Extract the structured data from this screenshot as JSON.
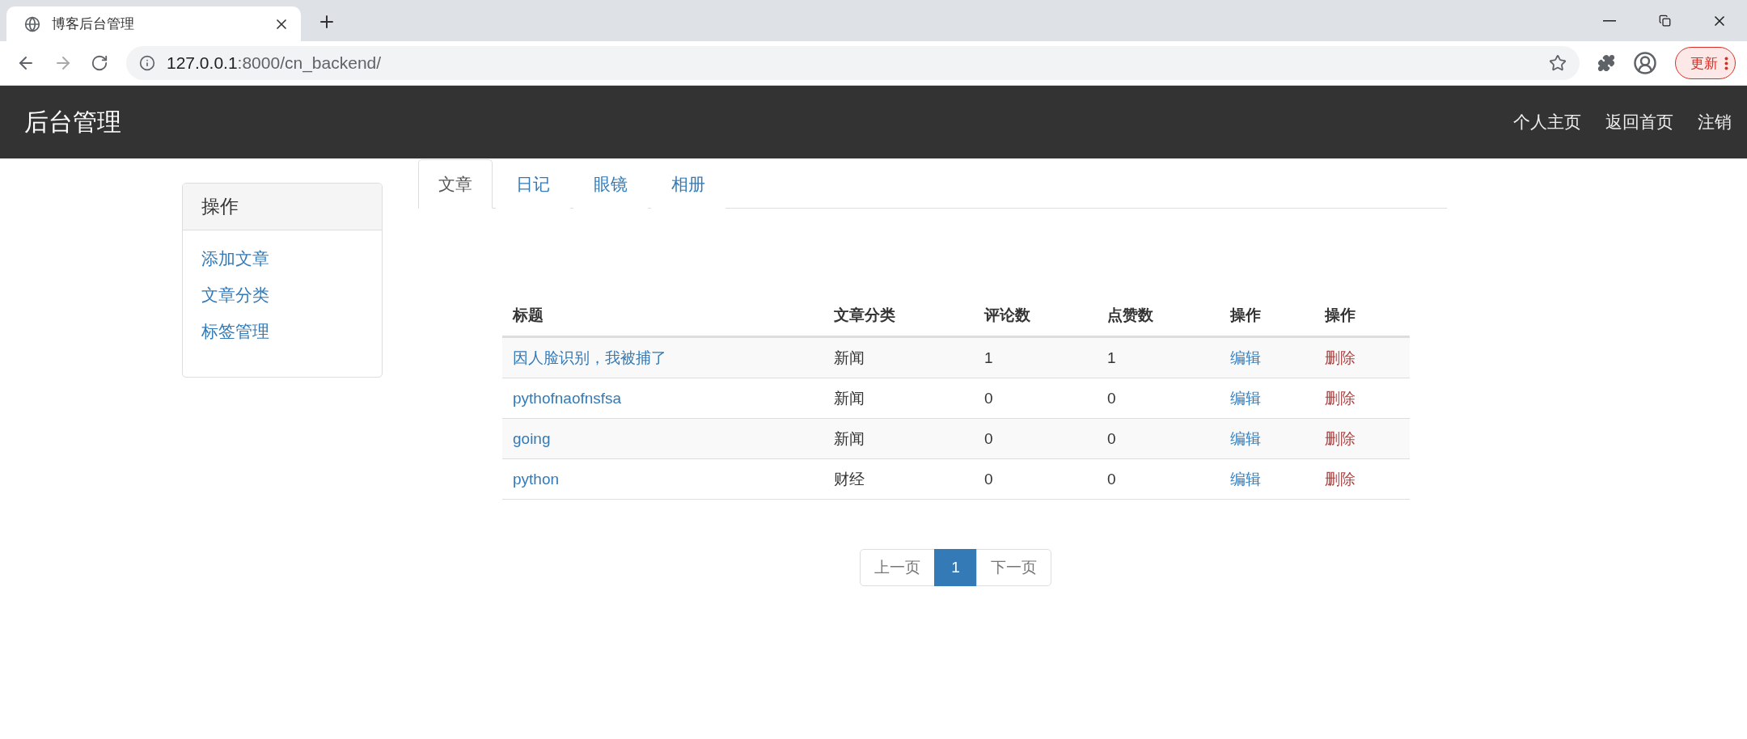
{
  "browser": {
    "tab_title": "博客后台管理",
    "url_host": "127.0.0.1",
    "url_path": ":8000/cn_backend/",
    "update_button": "更新"
  },
  "navbar": {
    "brand": "后台管理",
    "links": [
      "个人主页",
      "返回首页",
      "注销"
    ]
  },
  "sidebar": {
    "heading": "操作",
    "links": [
      "添加文章",
      "文章分类",
      "标签管理"
    ]
  },
  "tabs": [
    {
      "label": "文章",
      "selected": true
    },
    {
      "label": "日记",
      "selected": false
    },
    {
      "label": "眼镜",
      "selected": false
    },
    {
      "label": "相册",
      "selected": false
    }
  ],
  "table": {
    "columns": [
      "标题",
      "文章分类",
      "评论数",
      "点赞数",
      "操作",
      "操作"
    ],
    "rows": [
      {
        "title": "因人脸识别，我被捕了",
        "category": "新闻",
        "comments": "1",
        "likes": "1",
        "edit": "编辑",
        "delete": "删除"
      },
      {
        "title": "pythofnaofnsfsa",
        "category": "新闻",
        "comments": "0",
        "likes": "0",
        "edit": "编辑",
        "delete": "删除"
      },
      {
        "title": "going",
        "category": "新闻",
        "comments": "0",
        "likes": "0",
        "edit": "编辑",
        "delete": "删除"
      },
      {
        "title": "python",
        "category": "财经",
        "comments": "0",
        "likes": "0",
        "edit": "编辑",
        "delete": "删除"
      }
    ]
  },
  "pagination": {
    "previous": "上一页",
    "pages": [
      {
        "label": "1",
        "selected": true
      }
    ],
    "next": "下一页"
  }
}
